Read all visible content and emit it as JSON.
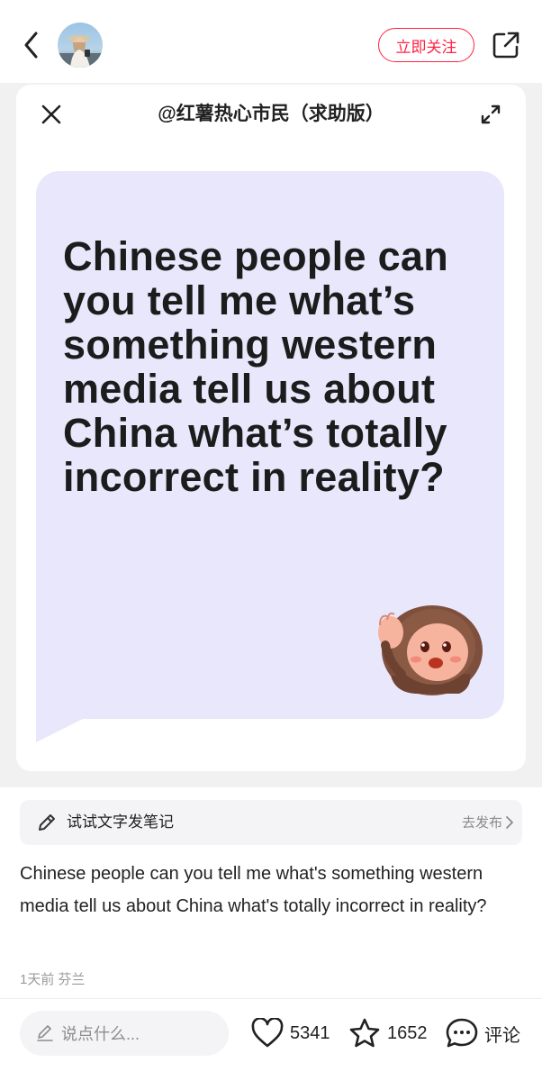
{
  "header": {
    "back_icon": "chevron-left-icon",
    "avatar_icon": "user-avatar",
    "follow_label": "立即关注",
    "share_icon": "share-icon",
    "accent_color": "#ff2442"
  },
  "card": {
    "close_icon": "close-icon",
    "title": "@红薯热心市民（求助版）",
    "expand_icon": "expand-icon",
    "bubble_text": "Chinese people can you tell me what’s something western media tell us about China what’s totally incorrect in reality?",
    "bubble_color": "#e8e7fb",
    "mascot_icon": "waving-mascot-sticker"
  },
  "prompt": {
    "icon": "pencil-icon",
    "label": "试试文字发笔记",
    "action": "去发布",
    "chevron_icon": "chevron-right-icon"
  },
  "post": {
    "text": "Chinese people can you tell me what's something western media tell us about China what's totally incorrect in reality?",
    "time": "1天前",
    "location": "芬兰"
  },
  "bottom_bar": {
    "comment_placeholder": "说点什么...",
    "like_count": "5341",
    "collect_count": "1652",
    "comment_label": "评论"
  }
}
